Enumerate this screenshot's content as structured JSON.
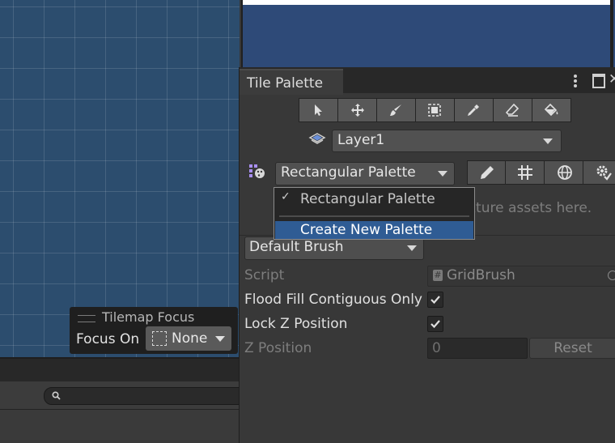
{
  "window": {
    "tab_title": "Tile Palette",
    "close_glyph": "✕"
  },
  "tools": [
    {
      "name": "select-icon"
    },
    {
      "name": "move-icon"
    },
    {
      "name": "paintbrush-icon"
    },
    {
      "name": "box-fill-icon"
    },
    {
      "name": "eyedropper-icon"
    },
    {
      "name": "eraser-icon"
    },
    {
      "name": "bucket-fill-icon"
    }
  ],
  "layer": {
    "selected": "Layer1"
  },
  "palette": {
    "selected": "Rectangular Palette",
    "options": [
      "Rectangular Palette"
    ],
    "create_label": "Create New Palette",
    "hint": "xture assets here."
  },
  "palette_tools": [
    "edit-icon",
    "grid-icon",
    "gizmo-icon",
    "settings-icon"
  ],
  "brush": {
    "selected": "Default Brush"
  },
  "props": {
    "script_label": "Script",
    "script_value": "GridBrush",
    "flood_label": "Flood Fill Contiguous Only",
    "flood_checked": true,
    "lockz_label": "Lock Z Position",
    "lockz_checked": true,
    "zpos_label": "Z Position",
    "zpos_value": "0",
    "reset_label": "Reset"
  },
  "focus_overlay": {
    "title": "Tilemap Focus",
    "label": "Focus On",
    "value": "None"
  },
  "colors": {
    "scene": "#2c4d6e",
    "highlight": "#2f5c94",
    "panel": "#383838"
  }
}
